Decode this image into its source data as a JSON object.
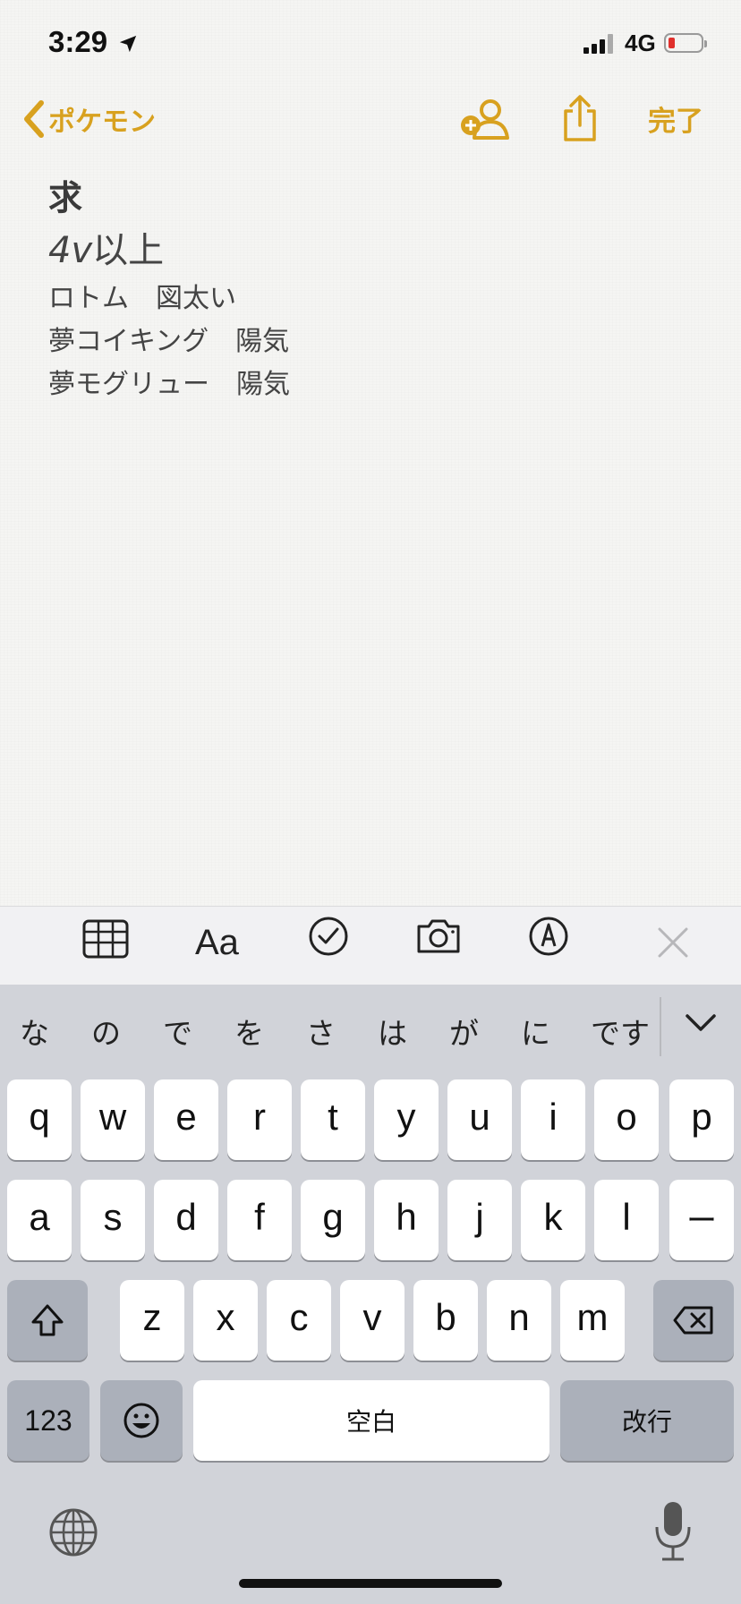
{
  "status_bar": {
    "time": "3:29",
    "network": "4G",
    "battery_color": "#e0302c"
  },
  "nav": {
    "back_label": "ポケモン",
    "done_label": "完了",
    "accent_color": "#d8a11f",
    "icons": [
      "add-person-icon",
      "share-icon"
    ]
  },
  "note": {
    "title": "求",
    "heading_latin": "4v",
    "heading_rest": "以上",
    "lines": [
      "ロトム　図太い",
      "夢コイキング　陽気",
      "夢モグリュー　陽気"
    ]
  },
  "toolbar": {
    "format_label": "Aa",
    "icons": [
      "table-icon",
      "format-icon",
      "checklist-icon",
      "camera-icon",
      "markup-icon",
      "close-icon"
    ]
  },
  "keyboard": {
    "candidates": [
      "な",
      "の",
      "で",
      "を",
      "さ",
      "は",
      "が",
      "に",
      "です"
    ],
    "rows": [
      [
        "q",
        "w",
        "e",
        "r",
        "t",
        "y",
        "u",
        "i",
        "o",
        "p"
      ],
      [
        "a",
        "s",
        "d",
        "f",
        "g",
        "h",
        "j",
        "k",
        "l",
        "ー"
      ],
      [
        "z",
        "x",
        "c",
        "v",
        "b",
        "n",
        "m"
      ]
    ],
    "numbers_label": "123",
    "space_label": "空白",
    "return_label": "改行"
  }
}
